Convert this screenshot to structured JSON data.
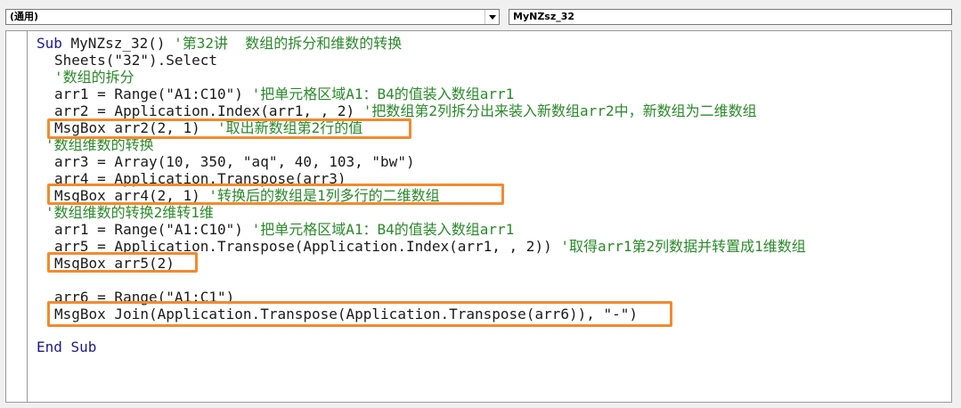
{
  "procedure_combo": {
    "value": "(通用)"
  },
  "member_combo": {
    "value": "MyNZsz_32"
  },
  "code_lines": [
    {
      "spans": [
        {
          "kind": "kw",
          "text": "Sub "
        },
        {
          "kind": "tx",
          "text": "MyNZsz_32() "
        },
        {
          "kind": "cm",
          "text": "'第32讲  数组的拆分和维数的转换"
        }
      ]
    },
    {
      "spans": [
        {
          "kind": "tx",
          "text": "Sheets(\"32\").Select"
        }
      ]
    },
    {
      "spans": [
        {
          "kind": "cm",
          "text": "'数组的拆分"
        }
      ]
    },
    {
      "spans": [
        {
          "kind": "tx",
          "text": "arr1 = Range(\"A1:C10\") "
        },
        {
          "kind": "cm",
          "text": "'把单元格区域A1：B4的值装入数组arr1"
        }
      ]
    },
    {
      "spans": [
        {
          "kind": "tx",
          "text": "arr2 = Application.Index(arr1, , 2) "
        },
        {
          "kind": "cm",
          "text": "'把数组第2列拆分出来装入新数组arr2中，新数组为二维数组"
        }
      ]
    },
    {
      "spans": [
        {
          "kind": "tx",
          "text": "MsgBox arr2(2, 1)  "
        },
        {
          "kind": "cm",
          "text": "'取出新数组第2行的值"
        }
      ]
    },
    {
      "spans": [
        {
          "kind": "cm",
          "text": "'数组维数的转换"
        }
      ]
    },
    {
      "spans": [
        {
          "kind": "tx",
          "text": "arr3 = Array(10, 350, \"aq\", 40, 103, \"bw\")"
        }
      ]
    },
    {
      "spans": [
        {
          "kind": "tx",
          "text": "arr4 = Application.Transpose(arr3)"
        }
      ]
    },
    {
      "spans": [
        {
          "kind": "tx",
          "text": "MsgBox arr4(2, 1) "
        },
        {
          "kind": "cm",
          "text": "'转换后的数组是1列多行的二维数组"
        }
      ]
    },
    {
      "spans": [
        {
          "kind": "cm",
          "text": "'数组维数的转换2维转1维"
        }
      ]
    },
    {
      "spans": [
        {
          "kind": "tx",
          "text": "arr1 = Range(\"A1:C10\") "
        },
        {
          "kind": "cm",
          "text": "'把单元格区域A1：B4的值装入数组arr1"
        }
      ]
    },
    {
      "spans": [
        {
          "kind": "tx",
          "text": "arr5 = Application.Transpose(Application.Index(arr1, , 2)) "
        },
        {
          "kind": "cm",
          "text": "'取得arr1第2列数据并转置成1维数组"
        }
      ]
    },
    {
      "spans": [
        {
          "kind": "tx",
          "text": "MsgBox arr5(2)"
        }
      ]
    },
    {
      "spans": []
    },
    {
      "spans": [
        {
          "kind": "tx",
          "text": "arr6 = Range(\"A1:C1\")"
        }
      ]
    },
    {
      "spans": [
        {
          "kind": "tx",
          "text": "MsgBox Join(Application.Transpose(Application.Transpose(arr6)), \"-\")"
        }
      ]
    },
    {
      "spans": []
    },
    {
      "spans": [
        {
          "kind": "kw",
          "text": "End Sub"
        }
      ]
    }
  ],
  "annotation_color": "#f28a2e"
}
